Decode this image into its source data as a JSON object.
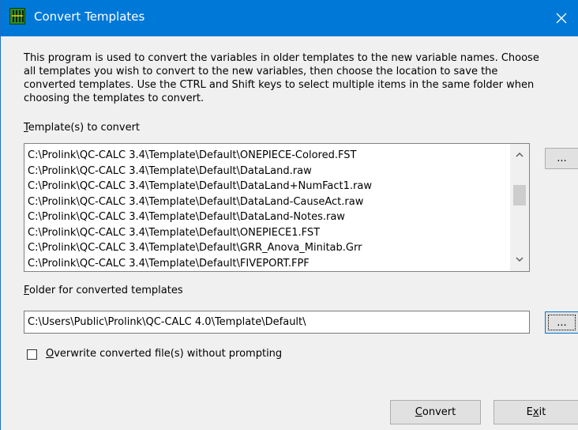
{
  "window": {
    "title": "Convert Templates",
    "app_icon": "grid-app-icon",
    "close_icon": "close-icon"
  },
  "description": "This program is used to convert the variables in older templates to the new variable names. Choose all templates you wish to convert to the new variables, then choose the location to save the converted templates. Use the CTRL and Shift keys to select multiple items in the same folder when choosing the templates to convert.",
  "templates_section": {
    "label_mnemonic": "T",
    "label_rest": "emplate(s) to convert",
    "items": [
      "C:\\Prolink\\QC-CALC 3.4\\Template\\Default\\ONEPIECE-Colored.FST",
      "C:\\Prolink\\QC-CALC 3.4\\Template\\Default\\DataLand.raw",
      "C:\\Prolink\\QC-CALC 3.4\\Template\\Default\\DataLand+NumFact1.raw",
      "C:\\Prolink\\QC-CALC 3.4\\Template\\Default\\DataLand-CauseAct.raw",
      "C:\\Prolink\\QC-CALC 3.4\\Template\\Default\\DataLand-Notes.raw",
      "C:\\Prolink\\QC-CALC 3.4\\Template\\Default\\ONEPIECE1.FST",
      "C:\\Prolink\\QC-CALC 3.4\\Template\\Default\\GRR_Anova_Minitab.Grr",
      "C:\\Prolink\\QC-CALC 3.4\\Template\\Default\\FIVEPORT.FPF"
    ],
    "browse_label": "..."
  },
  "folder_section": {
    "label_mnemonic": "F",
    "label_rest": "older for converted templates",
    "value": "C:\\Users\\Public\\Prolink\\QC-CALC 4.0\\Template\\Default\\",
    "browse_label": "..."
  },
  "overwrite": {
    "label_mnemonic": "O",
    "label_rest": "verwrite converted file(s) without prompting",
    "checked": false
  },
  "buttons": {
    "convert_mnemonic": "C",
    "convert_rest": "onvert",
    "exit_pre": "E",
    "exit_mnemonic": "x",
    "exit_rest": "it"
  },
  "colors": {
    "titlebar": "#0078d7",
    "window_bg": "#f0f0f0"
  }
}
